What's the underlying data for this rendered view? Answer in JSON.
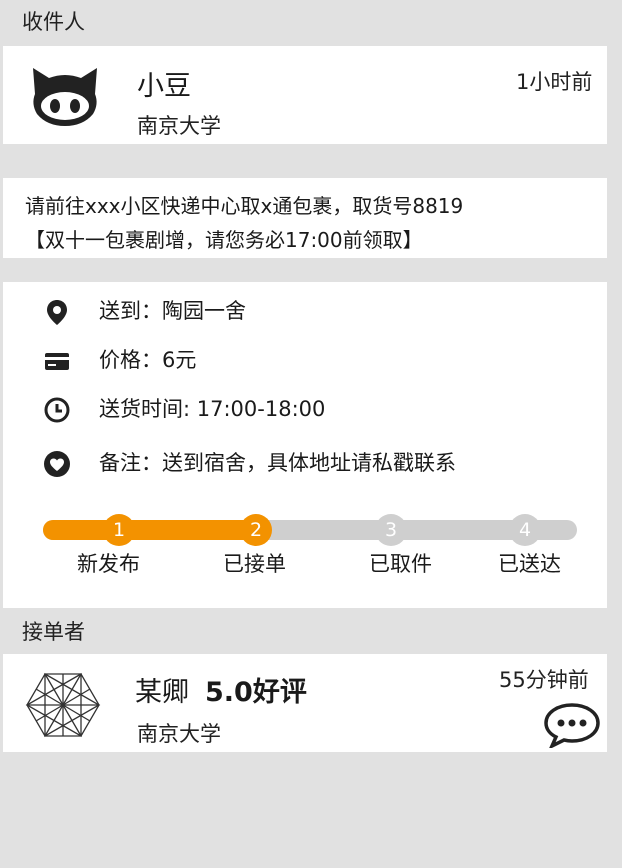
{
  "recipient": {
    "section_title": "收件人",
    "name": "小豆",
    "school": "南京大学",
    "time": "1小时前",
    "avatar_icon": "github-octocat-icon"
  },
  "message": {
    "line1": "请前往xxx小区快递中心取x通包裹，取货号8819",
    "line2": "【双十一包裹剧增，请您务必17:00前领取】"
  },
  "details": {
    "items": [
      {
        "icon": "location-pin-icon",
        "text": "送到：陶园一舍"
      },
      {
        "icon": "credit-card-icon",
        "text": "价格：6元"
      },
      {
        "icon": "clock-icon",
        "text": "送货时间: 17:00-18:00"
      },
      {
        "icon": "heart-icon",
        "text": "备注：送到宿舍，具体地址请私戳联系"
      }
    ]
  },
  "progress": {
    "current_step": 2,
    "total_steps": 4,
    "accent_color": "#f39200",
    "inactive_color": "#cfcfcf",
    "steps": [
      {
        "number": "1",
        "label": "新发布"
      },
      {
        "number": "2",
        "label": "已接单"
      },
      {
        "number": "3",
        "label": "已取件"
      },
      {
        "number": "4",
        "label": "已送达"
      }
    ]
  },
  "taker": {
    "section_title": "接单者",
    "name": "某卿",
    "rating": "5.0好评",
    "school": "南京大学",
    "time": "55分钟前",
    "avatar_icon": "geometric-hexagon-icon",
    "chat_icon": "chat-bubble-icon"
  }
}
